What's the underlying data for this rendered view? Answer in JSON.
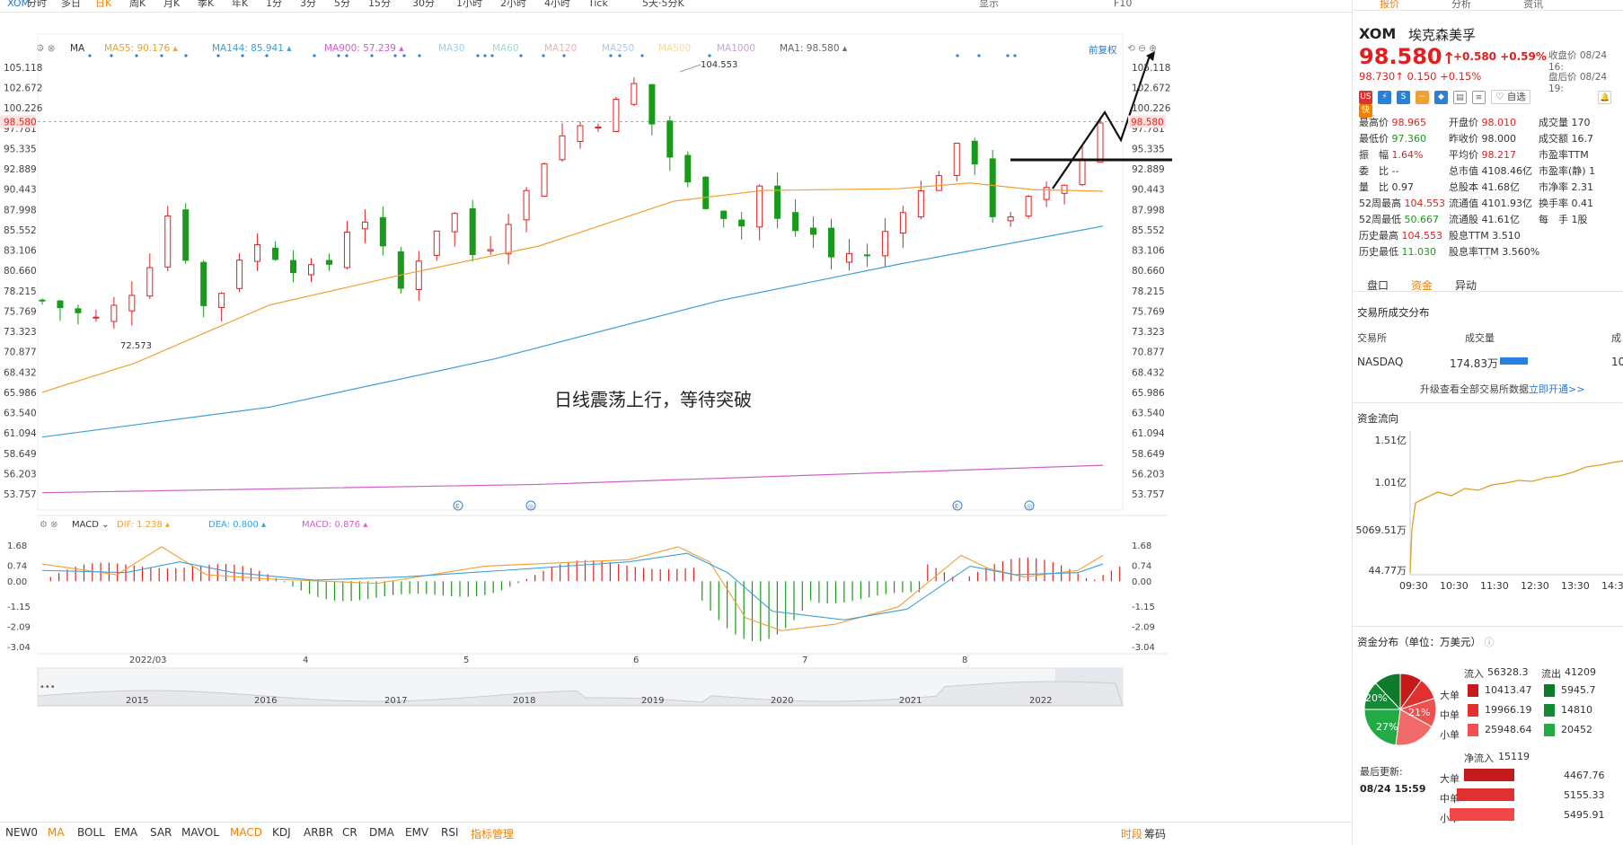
{
  "toolbar": {
    "symbol": "XOM",
    "periods": [
      "分时",
      "多日",
      "日K",
      "周K",
      "月K",
      "季K",
      "年K",
      "1分",
      "3分",
      "5分",
      "15分",
      "30分",
      "1小时",
      "2小时",
      "4小时",
      "Tick",
      "5天·5分K"
    ],
    "active_period": "日K",
    "right": [
      "显示",
      "F10"
    ]
  },
  "ma_indicators": {
    "label": "MA",
    "items": [
      {
        "text": "MA55: 90.176",
        "color": "#f0a030"
      },
      {
        "text": "MA144: 85.941",
        "color": "#3aa0d8"
      },
      {
        "text": "MA900: 57.239",
        "color": "#d060c8"
      },
      {
        "text": "MA30",
        "color": "#9bd0f0"
      },
      {
        "text": "MA60",
        "color": "#9be0c0"
      },
      {
        "text": "MA120",
        "color": "#f0b0b0"
      },
      {
        "text": "MA250",
        "color": "#a8c8f0"
      },
      {
        "text": "MA500",
        "color": "#f8d8a0"
      },
      {
        "text": "MA1000",
        "color": "#c8a0e0"
      },
      {
        "text": "MA1: 98.580",
        "color": "#666666"
      }
    ],
    "adjust": "前复权"
  },
  "price_axis": [
    "105.118",
    "102.672",
    "100.226",
    "97.781",
    "95.335",
    "92.889",
    "90.443",
    "87.998",
    "85.552",
    "83.106",
    "80.660",
    "78.215",
    "75.769",
    "73.323",
    "70.877",
    "68.432",
    "65.986",
    "63.540",
    "61.094",
    "58.649",
    "56.203",
    "53.757"
  ],
  "current_price_tag": "98.580",
  "high_label": "104.553",
  "low_label": "72.573",
  "annotation": "日线震荡上行，等待突破",
  "macd": {
    "label": "MACD",
    "dif": "DIF: 1.238",
    "dea": "DEA: 0.800",
    "macd": "MACD: 0.876",
    "axis": [
      "1.68",
      "0.74",
      "0.00",
      "-1.15",
      "-2.09",
      "-3.04"
    ]
  },
  "date_axis": [
    "2022/03",
    "4",
    "5",
    "6",
    "7",
    "8"
  ],
  "overview_years": [
    "2015",
    "2016",
    "2017",
    "2018",
    "2019",
    "2020",
    "2021",
    "2022"
  ],
  "bottom_bar": {
    "items": [
      "NEW0",
      "MA",
      "BOLL",
      "EMA",
      "SAR",
      "MAVOL",
      "MACD",
      "KDJ",
      "ARBR",
      "CR",
      "DMA",
      "EMV",
      "RSI"
    ],
    "active": [
      "MA",
      "MACD"
    ],
    "manage": "指标管理",
    "right": [
      "时段",
      "筹码"
    ]
  },
  "panel": {
    "tabs": [
      "报价",
      "分析",
      "资讯"
    ],
    "symbol": "XOM",
    "name": "埃克森美孚",
    "price": "98.580",
    "arrow": "↑",
    "change": "+0.580",
    "change_pct": "+0.59%",
    "close_label": "收盘价 08/24 16:",
    "after_hours": "98.730↑  0.150  +0.15%",
    "after_label": "盘后价 08/24 19:",
    "zixuan": "自选",
    "stats": [
      [
        {
          "k": "最高价",
          "v": "98.965",
          "c": "red"
        },
        {
          "k": "开盘价",
          "v": "98.010",
          "c": "red"
        },
        {
          "k": "成交量",
          "v": "170",
          "c": ""
        }
      ],
      [
        {
          "k": "最低价",
          "v": "97.360",
          "c": "green"
        },
        {
          "k": "昨收价",
          "v": "98.000",
          "c": ""
        },
        {
          "k": "成交额",
          "v": "16.7",
          "c": ""
        }
      ],
      [
        {
          "k": "振　幅",
          "v": "1.64%",
          "c": "red"
        },
        {
          "k": "平均价",
          "v": "98.217",
          "c": "red"
        },
        {
          "k": "市盈率TTM",
          "v": "",
          "c": ""
        }
      ],
      [
        {
          "k": "委　比",
          "v": "--",
          "c": ""
        },
        {
          "k": "总市值",
          "v": "4108.46亿",
          "c": ""
        },
        {
          "k": "市盈率(静)",
          "v": "1",
          "c": ""
        }
      ],
      [
        {
          "k": "量　比",
          "v": "0.97",
          "c": ""
        },
        {
          "k": "总股本",
          "v": "41.68亿",
          "c": ""
        },
        {
          "k": "市净率",
          "v": "2.31",
          "c": ""
        }
      ],
      [
        {
          "k": "52周最高",
          "v": "104.553",
          "c": "red"
        },
        {
          "k": "流通值",
          "v": "4101.93亿",
          "c": ""
        },
        {
          "k": "换手率",
          "v": "0.41",
          "c": ""
        }
      ],
      [
        {
          "k": "52周最低",
          "v": "50.667",
          "c": "green"
        },
        {
          "k": "流通股",
          "v": "41.61亿",
          "c": ""
        },
        {
          "k": "每　手",
          "v": "1股",
          "c": ""
        }
      ],
      [
        {
          "k": "历史最高",
          "v": "104.553",
          "c": "red"
        },
        {
          "k": "股息TTM",
          "v": "3.510",
          "c": ""
        },
        {
          "k": "",
          "v": "",
          "c": ""
        }
      ],
      [
        {
          "k": "历史最低",
          "v": "11.030",
          "c": "green"
        },
        {
          "k": "股息率TTM",
          "v": "3.560%",
          "c": ""
        },
        {
          "k": "",
          "v": "",
          "c": ""
        }
      ]
    ],
    "subtabs": [
      "盘口",
      "资金",
      "异动"
    ],
    "active_subtab": "资金",
    "exchange_title": "交易所成交分布",
    "exchange_headers": [
      "交易所",
      "成交量",
      "成"
    ],
    "exchange_row": {
      "name": "NASDAQ",
      "volume": "174.83万",
      "rest": "10"
    },
    "upgrade_text": "升级查看全部交易所数据",
    "upgrade_link": "立即开通>>",
    "flow_title": "资金流向",
    "flow_axis": [
      "1.51亿",
      "1.01亿",
      "5069.51万",
      "44.77万"
    ],
    "flow_times": [
      "09:30",
      "10:30",
      "11:30",
      "12:30",
      "13:30",
      "14:30"
    ],
    "dist_title": "资金分布（单位：万美元）",
    "inflow_label": "流入",
    "inflow": "56328.3",
    "outflow_label": "流出",
    "outflow": "41209",
    "pie_labels": [
      "20%",
      "27%",
      "21%"
    ],
    "rows": [
      {
        "k": "大单",
        "in": "10413.47",
        "out": "5945.7"
      },
      {
        "k": "中单",
        "in": "19966.19",
        "out": "14810"
      },
      {
        "k": "小单",
        "in": "25948.64",
        "out": "20452"
      }
    ],
    "net_label": "净流入",
    "net": "15119",
    "last_update_label": "最后更新:",
    "last_update": "08/24 15:59",
    "net_rows": [
      {
        "k": "大单",
        "v": "4467.76"
      },
      {
        "k": "中单",
        "v": "5155.33"
      },
      {
        "k": "小单",
        "v": "5495.91"
      }
    ]
  }
}
